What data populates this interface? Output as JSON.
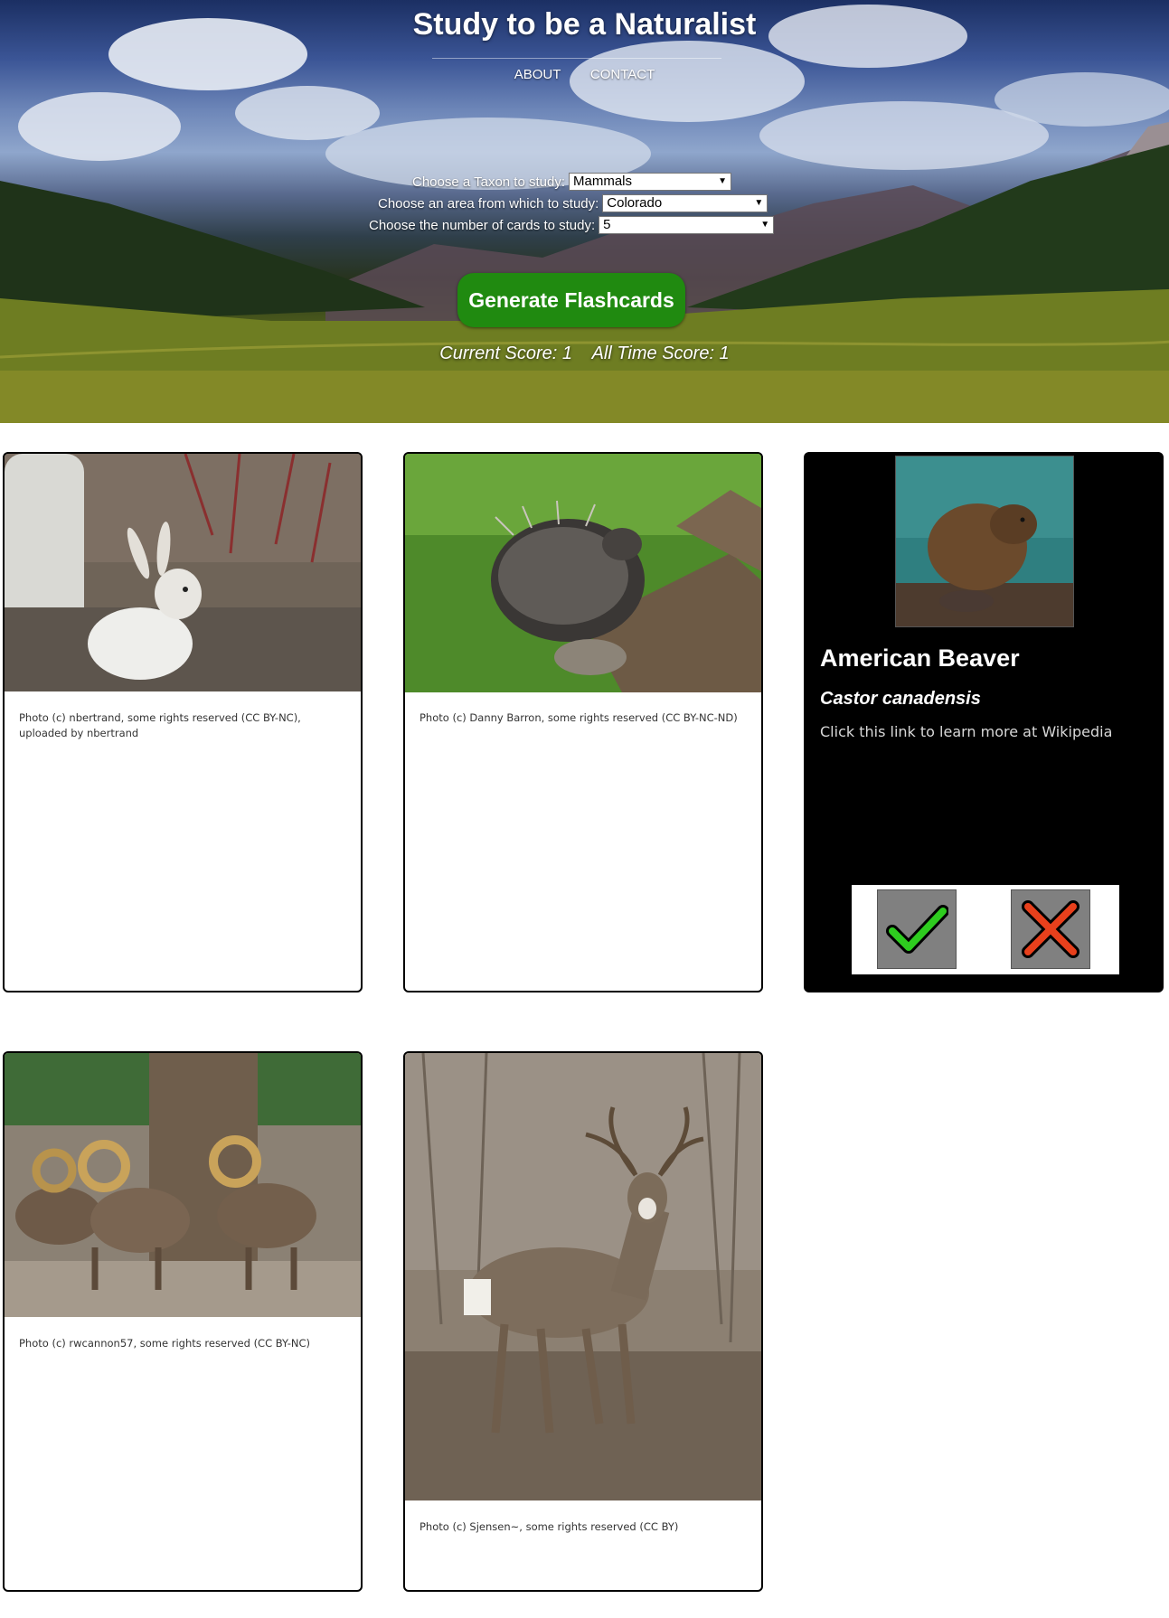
{
  "site": {
    "title": "Study to be a Naturalist",
    "nav": [
      "ABOUT",
      "CONTACT"
    ]
  },
  "form": {
    "taxon_label": "Choose a Taxon to study:",
    "taxon_value": "Mammals",
    "area_label": "Choose an area from which to study:",
    "area_value": "Colorado",
    "count_label": "Choose the number of cards to study:",
    "count_value": "5",
    "generate_label": "Generate Flashcards"
  },
  "score": {
    "current": "Current Score: 1",
    "all_time": "All Time Score: 1"
  },
  "cards": [
    {
      "side": "front",
      "photo_subject": "white snowshoe hare",
      "credit": "Photo (c) nbertrand, some rights reserved (CC BY-NC), uploaded by nbertrand"
    },
    {
      "side": "front",
      "photo_subject": "porcupine on log",
      "credit": "Photo (c) Danny Barron, some rights reserved (CC BY-NC-ND)"
    },
    {
      "side": "back",
      "photo_subject": "beaver on rock",
      "common_name": "American Beaver",
      "scientific_name": "Castor canadensis",
      "wiki_link": "Click this link to learn more at Wikipedia",
      "correct_icon": "checkmark-icon",
      "incorrect_icon": "x-mark-icon"
    },
    {
      "side": "front",
      "photo_subject": "herd of bighorn sheep",
      "credit": "Photo (c) rwcannon57, some rights reserved (CC BY-NC)"
    },
    {
      "side": "front",
      "photo_subject": "mule deer buck",
      "credit": "Photo (c) Sjensen~, some rights reserved (CC BY)"
    }
  ],
  "colors": {
    "generate_button": "#208a10",
    "correct_check": "#2ecc1f",
    "incorrect_x": "#e8401c"
  }
}
